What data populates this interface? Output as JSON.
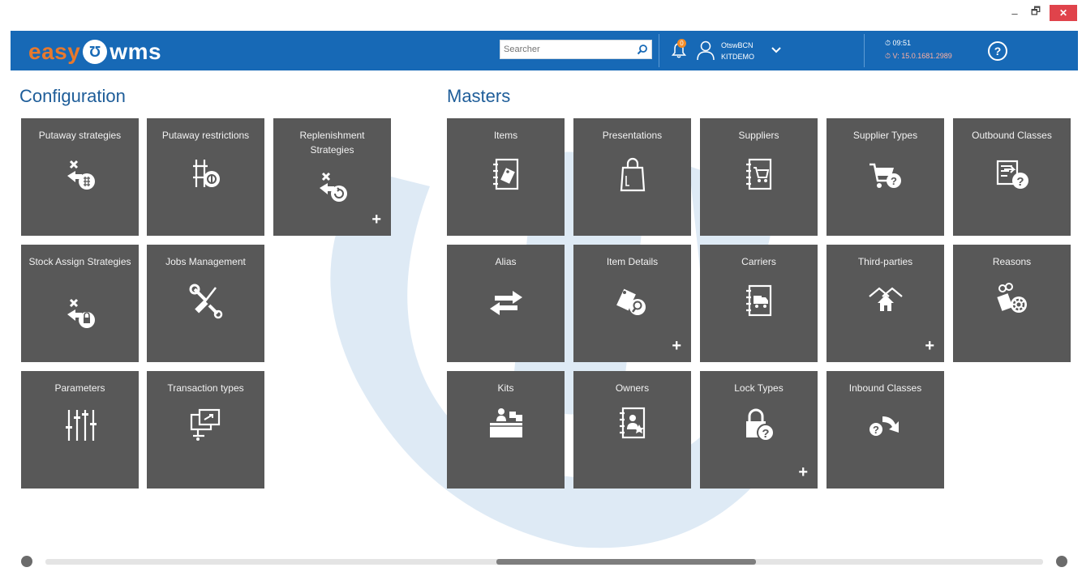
{
  "window": {
    "minimize": "–",
    "restore": "🗗",
    "close": "✕"
  },
  "header": {
    "logo_easy": "easy",
    "logo_mark": "Ʊ",
    "logo_wms": "wms",
    "search_placeholder": "Searcher",
    "notification_count": "0",
    "user_name": "OtswBCN",
    "user_company": "KITDEMO",
    "time": "09:51",
    "version": "V: 15.0.1681.2989",
    "help_label": "?"
  },
  "configuration": {
    "title": "Configuration",
    "tiles": [
      {
        "label": "Putaway strategies",
        "icon": "putaway-strategies-icon",
        "plus": ""
      },
      {
        "label": "Putaway restrictions",
        "icon": "putaway-restrictions-icon",
        "plus": ""
      },
      {
        "label": "Replenishment Strategies",
        "icon": "replenishment-strategies-icon",
        "plus": "+"
      },
      {
        "label": "Stock Assign Strategies",
        "icon": "stock-assign-icon",
        "plus": ""
      },
      {
        "label": "Jobs Management",
        "icon": "tools-icon",
        "plus": ""
      },
      {
        "label": "Parameters",
        "icon": "sliders-icon",
        "plus": ""
      },
      {
        "label": "Transaction types",
        "icon": "transaction-icon",
        "plus": ""
      }
    ]
  },
  "masters": {
    "title": "Masters",
    "tiles": [
      {
        "label": "Items",
        "icon": "items-icon",
        "plus": ""
      },
      {
        "label": "Presentations",
        "icon": "bag-icon",
        "plus": ""
      },
      {
        "label": "Suppliers",
        "icon": "suppliers-icon",
        "plus": ""
      },
      {
        "label": "Supplier Types",
        "icon": "supplier-types-icon",
        "plus": ""
      },
      {
        "label": "Outbound Classes",
        "icon": "outbound-classes-icon",
        "plus": ""
      },
      {
        "label": "Alias",
        "icon": "alias-arrows-icon",
        "plus": ""
      },
      {
        "label": "Item Details",
        "icon": "item-details-icon",
        "plus": "+"
      },
      {
        "label": "Carriers",
        "icon": "carriers-icon",
        "plus": ""
      },
      {
        "label": "Third-parties",
        "icon": "third-parties-icon",
        "plus": "+"
      },
      {
        "label": "Reasons",
        "icon": "reasons-icon",
        "plus": ""
      },
      {
        "label": "Kits",
        "icon": "kits-icon",
        "plus": ""
      },
      {
        "label": "Owners",
        "icon": "owners-icon",
        "plus": ""
      },
      {
        "label": "Lock Types",
        "icon": "lock-types-icon",
        "plus": "+"
      },
      {
        "label": "Inbound Classes",
        "icon": "inbound-classes-icon",
        "plus": ""
      }
    ]
  },
  "colors": {
    "header": "#1769b6",
    "tile": "#585858",
    "accent": "#e8792d",
    "title": "#1e5d99"
  }
}
